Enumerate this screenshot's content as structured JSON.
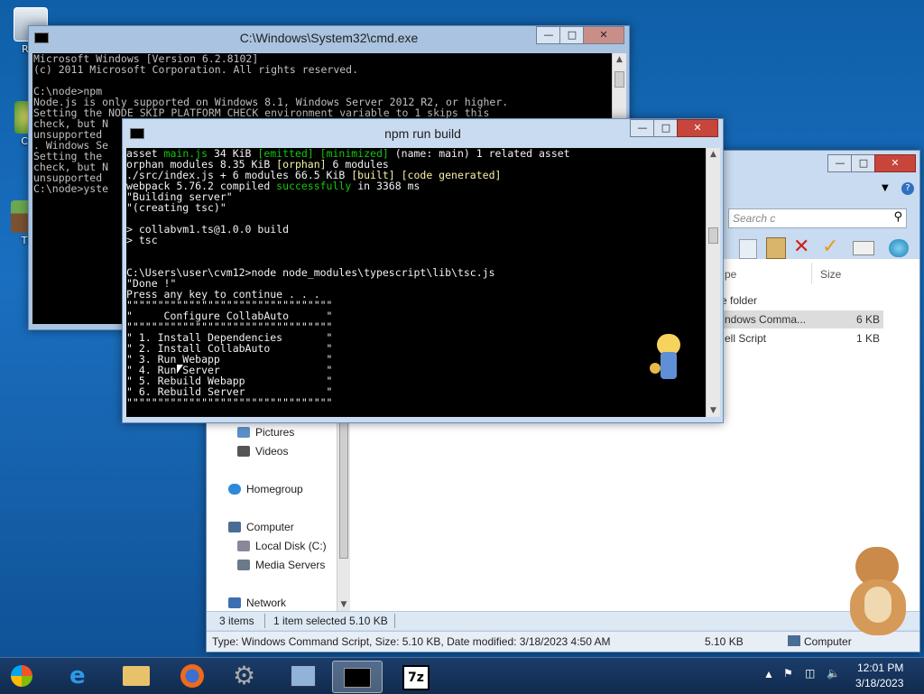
{
  "desktop": {
    "icons": [
      {
        "label": "Rec",
        "icon": "recycle-bin-icon"
      },
      {
        "label": "Cho",
        "icon": "app-icon"
      },
      {
        "label": "TL",
        "icon": "minecraft-icon"
      }
    ]
  },
  "cmd_window": {
    "title": "C:\\Windows\\System32\\cmd.exe",
    "lines": [
      "Microsoft Windows [Version 6.2.8102]",
      "(c) 2011 Microsoft Corporation. All rights reserved.",
      "",
      "C:\\node>npm",
      "Node.js is only supported on Windows 8.1, Windows Server 2012 R2, or higher.",
      "Setting the NODE_SKIP_PLATFORM_CHECK environment variable to 1 skips this",
      "check, but N",
      "unsupported",
      ". Windows Se",
      "Setting the",
      "check, but N",
      "unsupported",
      "C:\\node>yste"
    ]
  },
  "npm_window": {
    "title": "npm run build",
    "lines": [
      [
        {
          "t": "asset ",
          "c": "wht"
        },
        {
          "t": "main.js",
          "c": "grn"
        },
        {
          "t": " 34 KiB ",
          "c": "wht"
        },
        {
          "t": "[emitted] [minimized]",
          "c": "grn"
        },
        {
          "t": " (name: main) 1 related asset",
          "c": "wht"
        }
      ],
      [
        {
          "t": "orphan modules 8.35 KiB ",
          "c": "wht"
        },
        {
          "t": "[orphan]",
          "c": "yel"
        },
        {
          "t": " 6 modules",
          "c": "wht"
        }
      ],
      [
        {
          "t": "./src/index.js + 6 modules 66.5 KiB ",
          "c": "wht"
        },
        {
          "t": "[built] [code generated]",
          "c": "yel"
        }
      ],
      [
        {
          "t": "webpack 5.76.2 compiled ",
          "c": "wht"
        },
        {
          "t": "successfully",
          "c": "grn"
        },
        {
          "t": " in 3368 ms",
          "c": "wht"
        }
      ],
      [
        {
          "t": "\"Building server\"",
          "c": "wht"
        }
      ],
      [
        {
          "t": "\"(creating tsc)\"",
          "c": "wht"
        }
      ],
      [
        {
          "t": "",
          "c": "wht"
        }
      ],
      [
        {
          "t": "> collabvm1.ts@1.0.0 build",
          "c": "wht"
        }
      ],
      [
        {
          "t": "> tsc",
          "c": "wht"
        }
      ],
      [
        {
          "t": "",
          "c": "wht"
        }
      ],
      [
        {
          "t": "",
          "c": "wht"
        }
      ],
      [
        {
          "t": "C:\\Users\\user\\cvm12>node node_modules\\typescript\\lib\\tsc.js",
          "c": "wht"
        }
      ],
      [
        {
          "t": "\"Done !\"",
          "c": "wht"
        }
      ],
      [
        {
          "t": "Press any key to continue . . .",
          "c": "wht"
        }
      ],
      [
        {
          "t": "\"\"\"\"\"\"\"\"\"\"\"\"\"\"\"\"\"\"\"\"\"\"\"\"\"\"\"\"\"\"\"\"\"",
          "c": "wht"
        }
      ],
      [
        {
          "t": "\"     Configure CollabAuto      \"",
          "c": "wht"
        }
      ],
      [
        {
          "t": "\"\"\"\"\"\"\"\"\"\"\"\"\"\"\"\"\"\"\"\"\"\"\"\"\"\"\"\"\"\"\"\"\"",
          "c": "wht"
        }
      ],
      [
        {
          "t": "\" 1. Install Dependencies       \"",
          "c": "wht"
        }
      ],
      [
        {
          "t": "\" 2. Install CollabAuto         \"",
          "c": "wht"
        }
      ],
      [
        {
          "t": "\" 3. Run Webapp                 \"",
          "c": "wht"
        }
      ],
      [
        {
          "t": "\" 4. Run Server                 \"",
          "c": "wht"
        }
      ],
      [
        {
          "t": "\" 5. Rebuild Webapp             \"",
          "c": "wht"
        }
      ],
      [
        {
          "t": "\" 6. Rebuild Server             \"",
          "c": "wht"
        }
      ],
      [
        {
          "t": "\"\"\"\"\"\"\"\"\"\"\"\"\"\"\"\"\"\"\"\"\"\"\"\"\"\"\"\"\"\"\"\"\"",
          "c": "wht"
        }
      ]
    ]
  },
  "explorer": {
    "search_placeholder": "Search c",
    "columns": {
      "type": "pe",
      "size": "Size"
    },
    "files": [
      {
        "type": "e folder",
        "size": ""
      },
      {
        "type": "ndows Comma...",
        "size": "6 KB"
      },
      {
        "type": "ell Script",
        "size": "1 KB"
      }
    ],
    "nav": {
      "pictures": "Pictures",
      "videos": "Videos",
      "homegroup": "Homegroup",
      "computer": "Computer",
      "local_disk": "Local Disk (C:)",
      "media_servers": "Media Servers",
      "network": "Network"
    },
    "status_items": "3 items",
    "status_selected": "1 item selected  5.10 KB",
    "details_text": "Type: Windows Command Script, Size: 5.10 KB, Date modified: 3/18/2023 4:50 AM",
    "details_size": "5.10 KB",
    "details_location": "Computer"
  },
  "taskbar": {
    "apps": [
      "start-orb",
      "internet-explorer-icon",
      "file-explorer-icon",
      "firefox-icon",
      "settings-gear-icon",
      "remote-desktop-icon",
      "cmd-icon",
      "7zip-icon"
    ],
    "sevenzip_label": "7z",
    "time": "12:01 PM",
    "date": "3/18/2023"
  }
}
